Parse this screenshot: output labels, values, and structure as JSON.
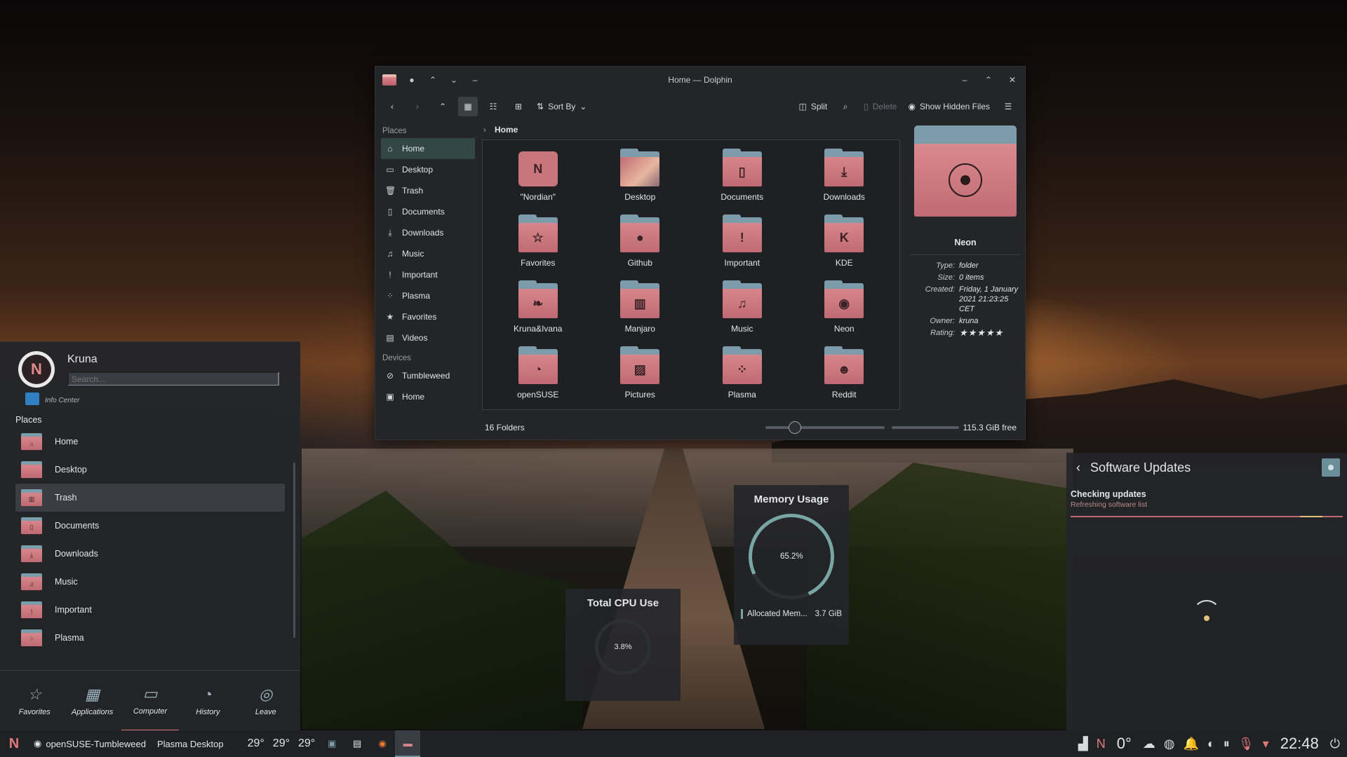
{
  "dolphin": {
    "title": "Home — Dolphin",
    "toolbar": {
      "sort_by": "Sort By",
      "split": "Split",
      "delete": "Delete",
      "show_hidden": "Show Hidden Files"
    },
    "places_header": "Places",
    "places": [
      {
        "label": "Home",
        "icon": "home-icon",
        "glyph": "⌂"
      },
      {
        "label": "Desktop",
        "icon": "desktop-icon",
        "glyph": "▭"
      },
      {
        "label": "Trash",
        "icon": "trash-icon",
        "glyph": "🗑"
      },
      {
        "label": "Documents",
        "icon": "documents-icon",
        "glyph": "▯"
      },
      {
        "label": "Downloads",
        "icon": "downloads-icon",
        "glyph": "⤓"
      },
      {
        "label": "Music",
        "icon": "music-icon",
        "glyph": "♫"
      },
      {
        "label": "Important",
        "icon": "important-icon",
        "glyph": "!"
      },
      {
        "label": "Plasma",
        "icon": "plasma-icon",
        "glyph": "⁘"
      },
      {
        "label": "Favorites",
        "icon": "star-icon",
        "glyph": "★"
      },
      {
        "label": "Videos",
        "icon": "videos-icon",
        "glyph": "▤"
      }
    ],
    "devices_header": "Devices",
    "devices": [
      {
        "label": "Tumbleweed",
        "icon": "drive-icon",
        "glyph": "⊘"
      },
      {
        "label": "Home",
        "icon": "drive-icon",
        "glyph": "▣"
      }
    ],
    "breadcrumb": "Home",
    "files": [
      {
        "name": "\"Nordian\"",
        "glyph": "N"
      },
      {
        "name": "Desktop",
        "glyph": ""
      },
      {
        "name": "Documents",
        "glyph": "▯"
      },
      {
        "name": "Downloads",
        "glyph": "⤓"
      },
      {
        "name": "Favorites",
        "glyph": "☆"
      },
      {
        "name": "Github",
        "glyph": "●"
      },
      {
        "name": "Important",
        "glyph": "!"
      },
      {
        "name": "KDE",
        "glyph": "K"
      },
      {
        "name": "Kruna&Ivana",
        "glyph": "❧"
      },
      {
        "name": "Manjaro",
        "glyph": "▥"
      },
      {
        "name": "Music",
        "glyph": "♫"
      },
      {
        "name": "Neon",
        "glyph": "◉"
      },
      {
        "name": "openSUSE",
        "glyph": "◔"
      },
      {
        "name": "Pictures",
        "glyph": "▨"
      },
      {
        "name": "Plasma",
        "glyph": "⁘"
      },
      {
        "name": "Reddit",
        "glyph": "☻"
      }
    ],
    "info": {
      "name": "Neon",
      "type_label": "Type:",
      "type": "folder",
      "size_label": "Size:",
      "size": "0 items",
      "created_label": "Created:",
      "created": "Friday, 1 January 2021 21:23:25 CET",
      "owner_label": "Owner:",
      "owner": "kruna",
      "rating_label": "Rating:",
      "rating": 5,
      "stars": "★★★★★"
    },
    "status": {
      "count": "16 Folders",
      "zoom": 0.25,
      "free": "115.3 GiB free"
    }
  },
  "launcher": {
    "user": "Kruna",
    "search_placeholder": "Search...",
    "partial_item": "Info Center",
    "section": "Places",
    "items": [
      {
        "label": "Home",
        "glyph": "⌂"
      },
      {
        "label": "Desktop",
        "glyph": ""
      },
      {
        "label": "Trash",
        "glyph": "▥"
      },
      {
        "label": "Documents",
        "glyph": "▯"
      },
      {
        "label": "Downloads",
        "glyph": "⤓"
      },
      {
        "label": "Music",
        "glyph": "♫"
      },
      {
        "label": "Important",
        "glyph": "!"
      },
      {
        "label": "Plasma",
        "glyph": "⁘"
      }
    ],
    "tabs": [
      {
        "label": "Favorites",
        "glyph": "☆"
      },
      {
        "label": "Applications",
        "glyph": "▦"
      },
      {
        "label": "Computer",
        "glyph": "▭"
      },
      {
        "label": "History",
        "glyph": "◔"
      },
      {
        "label": "Leave",
        "glyph": "◎"
      }
    ]
  },
  "cpu": {
    "title": "Total CPU Use",
    "value": "3.8%"
  },
  "memory": {
    "title": "Memory Usage",
    "value": "65.2%",
    "legend": "Allocated Mem...",
    "amount": "3.7 GiB"
  },
  "updates": {
    "title": "Software Updates",
    "status": "Checking updates",
    "substatus": "Refreshing software list"
  },
  "taskbar": {
    "distro": "openSUSE-Tumbleweed",
    "desktop": "Plasma Desktop",
    "temps": [
      "29°",
      "29°",
      "29°"
    ],
    "weather": "0°",
    "clock": "22:48"
  },
  "colors": {
    "accent": "#7aa5a5",
    "folder_front": "#c06a73",
    "folder_back": "#7d9cab",
    "panel": "#232529"
  }
}
